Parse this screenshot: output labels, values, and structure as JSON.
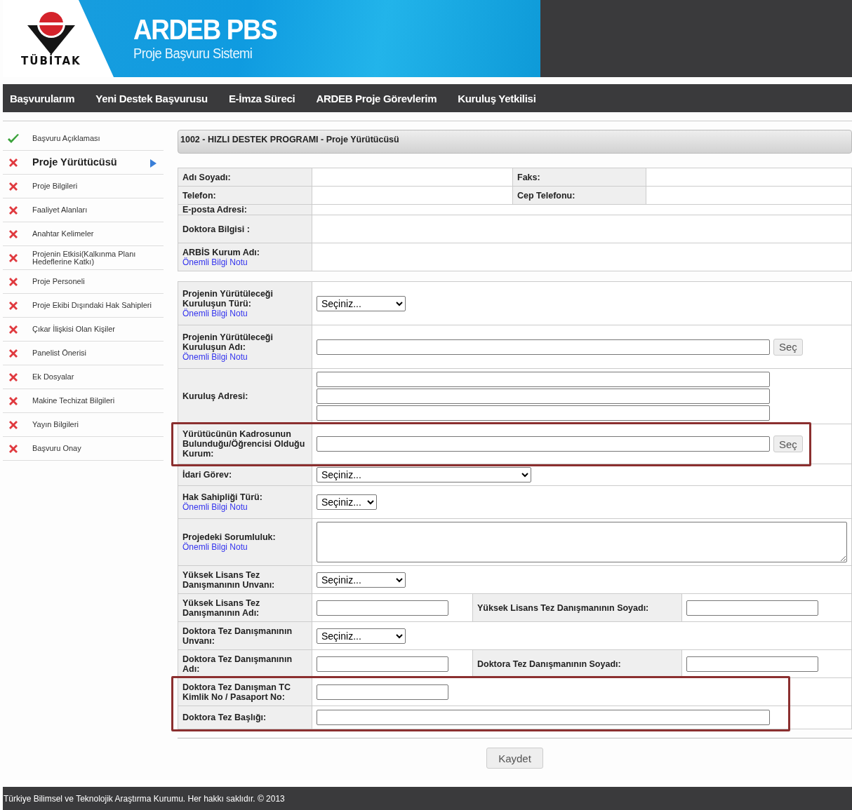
{
  "header": {
    "logo_text": "TÜBİTAK",
    "title": "ARDEB PBS",
    "subtitle": "Proje Başvuru Sistemi"
  },
  "nav": [
    "Başvurularım",
    "Yeni Destek Başvurusu",
    "E-İmza Süreci",
    "ARDEB Proje Görevlerim",
    "Kuruluş Yetkilisi"
  ],
  "sidebar": [
    {
      "label": "Başvuru Açıklaması",
      "completed": true,
      "selected": false
    },
    {
      "label": "Proje Yürütücüsü",
      "completed": false,
      "selected": true
    },
    {
      "label": "Proje Bilgileri",
      "completed": false,
      "selected": false
    },
    {
      "label": "Faaliyet Alanları",
      "completed": false,
      "selected": false
    },
    {
      "label": "Anahtar Kelimeler",
      "completed": false,
      "selected": false
    },
    {
      "label": "Projenin Etkisi(Kalkınma Planı Hedeflerine Katkı)",
      "completed": false,
      "selected": false
    },
    {
      "label": "Proje Personeli",
      "completed": false,
      "selected": false
    },
    {
      "label": "Proje Ekibi Dışındaki Hak Sahipleri",
      "completed": false,
      "selected": false
    },
    {
      "label": "Çıkar İlişkisi Olan Kişiler",
      "completed": false,
      "selected": false
    },
    {
      "label": "Panelist Önerisi",
      "completed": false,
      "selected": false
    },
    {
      "label": "Ek Dosyalar",
      "completed": false,
      "selected": false
    },
    {
      "label": "Makine Techizat Bilgileri",
      "completed": false,
      "selected": false
    },
    {
      "label": "Yayın Bilgileri",
      "completed": false,
      "selected": false
    },
    {
      "label": "Başvuru Onay",
      "completed": false,
      "selected": false
    }
  ],
  "panel_title": "1002 - HIZLI DESTEK PROGRAMI - Proje Yürütücüsü",
  "info_table": [
    {
      "label": "Adı Soyadı:",
      "label2": "Faks:"
    },
    {
      "label": "Telefon:",
      "label2": "Cep Telefonu:"
    },
    {
      "label": "E-posta Adresi:"
    },
    {
      "label": "Doktora Bilgisi :",
      "kind": "tall"
    },
    {
      "label": "ARBİS Kurum Adı:",
      "note": "Önemli Bilgi Notu",
      "kind": "tall"
    }
  ],
  "form": {
    "rows": [
      {
        "kind": "select",
        "label": "Projenin Yürütüleceği Kuruluşun Türü:",
        "note": "Önemli Bilgi Notu",
        "value": "Seçiniz...",
        "highlighted": false
      },
      {
        "kind": "lookup",
        "label": "Projenin Yürütüleceği Kuruluşun Adı:",
        "note": "Önemli Bilgi Notu",
        "button": "Seç",
        "highlighted": false
      },
      {
        "kind": "address",
        "label": "Kuruluş Adresi:",
        "highlighted": false
      },
      {
        "kind": "lookup",
        "label": "Yürütücünün Kadrosunun Bulunduğu/Öğrencisi Olduğu Kurum:",
        "button": "Seç",
        "highlighted": true
      },
      {
        "kind": "select",
        "label": "İdari Görev:",
        "value": "Seçiniz...",
        "highlighted": false
      },
      {
        "kind": "select",
        "label": "Hak Sahipliği Türü:",
        "note": "Önemli Bilgi Notu",
        "value": "Seçiniz...",
        "highlighted": false
      },
      {
        "kind": "textarea",
        "label": "Projedeki Sorumluluk:",
        "note": "Önemli Bilgi Notu",
        "highlighted": false
      },
      {
        "kind": "select",
        "label": "Yüksek Lisans Tez Danışmanının Unvanı:",
        "value": "Seçiniz...",
        "highlighted": false
      },
      {
        "kind": "pair",
        "label": "Yüksek Lisans Tez Danışmanının Adı:",
        "label2": "Yüksek Lisans Tez Danışmanının Soyadı:",
        "highlighted": false
      },
      {
        "kind": "select",
        "label": "Doktora Tez Danışmanının Unvanı:",
        "value": "Seçiniz...",
        "highlighted": false
      },
      {
        "kind": "pair",
        "label": "Doktora Tez Danışmanının Adı:",
        "label2": "Doktora Tez Danışmanının Soyadı:",
        "highlighted": false
      },
      {
        "kind": "text",
        "label": "Doktora Tez Danışman TC Kimlik No / Pasaport No:",
        "highlighted": true
      },
      {
        "kind": "text",
        "label": "Doktora Tez Başlığı:",
        "highlighted": true
      }
    ]
  },
  "save_button": "Kaydet",
  "footer": "Türkiye Bilimsel ve Teknolojik Araştırma Kurumu. Her hakkı saklıdır. © 2013"
}
